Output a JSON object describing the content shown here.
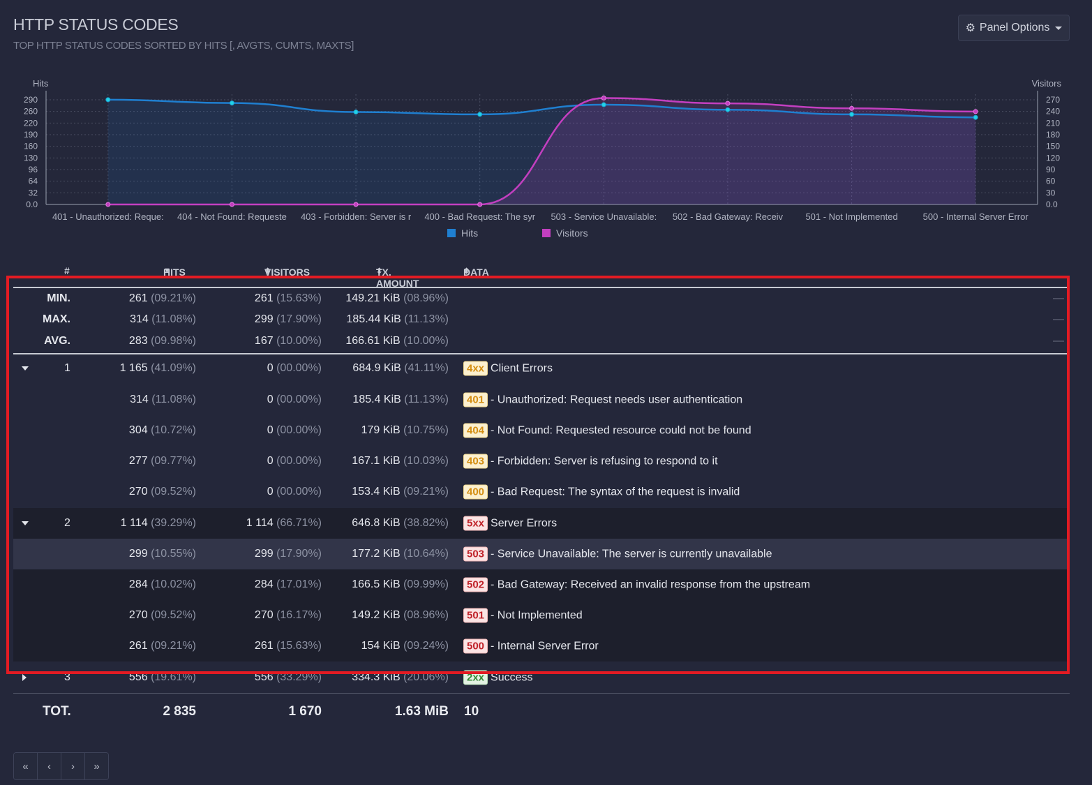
{
  "panel": {
    "title": "HTTP STATUS CODES",
    "subtitle": "TOP HTTP STATUS CODES SORTED BY HITS [, AVGTS, CUMTS, MAXTS]",
    "options_label": "Panel Options"
  },
  "chart_data": {
    "type": "area",
    "categories": [
      "401 - Unauthorized: Reque:",
      "404 - Not Found: Requeste",
      "403 - Forbidden: Server is r",
      "400 - Bad Request: The syr",
      "503 - Service Unavailable: ",
      "502 - Bad Gateway: Receiv",
      "501 - Not Implemented",
      "500 - Internal Server Error"
    ],
    "series": [
      {
        "name": "Hits",
        "values": [
          314,
          304,
          277,
          270,
          299,
          284,
          270,
          261
        ],
        "color": "#1f7fd0"
      },
      {
        "name": "Visitors",
        "values": [
          0,
          0,
          0,
          0,
          299,
          284,
          270,
          261
        ],
        "color": "#c33fc0"
      }
    ],
    "ylabel_left": "Hits",
    "ylabel_right": "Visitors",
    "yticks_left": [
      "290",
      "260",
      "220",
      "190",
      "160",
      "130",
      "96",
      "64",
      "32",
      "0.0"
    ],
    "yticks_right": [
      "270",
      "240",
      "210",
      "180",
      "150",
      "120",
      "90",
      "60",
      "30",
      "0.0"
    ],
    "ylim_left": [
      0,
      320
    ],
    "ylim_right": [
      0,
      300
    ],
    "legend_position": "bottom",
    "grid": true
  },
  "table": {
    "headers": {
      "num": "#",
      "hits": "HITS",
      "visitors": "VISITORS",
      "tx": "TX. AMOUNT",
      "data": "DATA"
    },
    "stats": [
      {
        "label": "MIN.",
        "hits": "261",
        "hits_pct": "(09.21%)",
        "visitors": "261",
        "visitors_pct": "(15.63%)",
        "tx": "149.21 KiB",
        "tx_pct": "(08.96%)",
        "dash": "—"
      },
      {
        "label": "MAX.",
        "hits": "314",
        "hits_pct": "(11.08%)",
        "visitors": "299",
        "visitors_pct": "(17.90%)",
        "tx": "185.44 KiB",
        "tx_pct": "(11.13%)",
        "dash": "—"
      },
      {
        "label": "AVG.",
        "hits": "283",
        "hits_pct": "(09.98%)",
        "visitors": "167",
        "visitors_pct": "(10.00%)",
        "tx": "166.61 KiB",
        "tx_pct": "(10.00%)",
        "dash": "—"
      }
    ],
    "groups": [
      {
        "num": "1",
        "hits": "1 165",
        "hits_pct": "(41.09%)",
        "visitors": "0",
        "visitors_pct": "(00.00%)",
        "tx": "684.9 KiB",
        "tx_pct": "(41.11%)",
        "badge": "4xx",
        "label": "Client Errors"
      },
      {
        "num": "2",
        "hits": "1 114",
        "hits_pct": "(39.29%)",
        "visitors": "1 114",
        "visitors_pct": "(66.71%)",
        "tx": "646.8 KiB",
        "tx_pct": "(38.82%)",
        "badge": "5xx",
        "label": "Server Errors"
      },
      {
        "num": "3",
        "hits": "556",
        "hits_pct": "(19.61%)",
        "visitors": "556",
        "visitors_pct": "(33.29%)",
        "tx": "334.3 KiB",
        "tx_pct": "(20.06%)",
        "badge": "2xx",
        "label": "Success"
      }
    ],
    "rows": [
      {
        "hits": "314",
        "hits_pct": "(11.08%)",
        "visitors": "0",
        "visitors_pct": "(00.00%)",
        "tx": "185.4 KiB",
        "tx_pct": "(11.13%)",
        "badge": "401",
        "label": "- Unauthorized: Request needs user authentication"
      },
      {
        "hits": "304",
        "hits_pct": "(10.72%)",
        "visitors": "0",
        "visitors_pct": "(00.00%)",
        "tx": "179 KiB",
        "tx_pct": "(10.75%)",
        "badge": "404",
        "label": "- Not Found: Requested resource could not be found"
      },
      {
        "hits": "277",
        "hits_pct": "(09.77%)",
        "visitors": "0",
        "visitors_pct": "(00.00%)",
        "tx": "167.1 KiB",
        "tx_pct": "(10.03%)",
        "badge": "403",
        "label": "- Forbidden: Server is refusing to respond to it"
      },
      {
        "hits": "270",
        "hits_pct": "(09.52%)",
        "visitors": "0",
        "visitors_pct": "(00.00%)",
        "tx": "153.4 KiB",
        "tx_pct": "(09.21%)",
        "badge": "400",
        "label": "- Bad Request: The syntax of the request is invalid"
      },
      {
        "hits": "299",
        "hits_pct": "(10.55%)",
        "visitors": "299",
        "visitors_pct": "(17.90%)",
        "tx": "177.2 KiB",
        "tx_pct": "(10.64%)",
        "badge": "503",
        "label": "- Service Unavailable: The server is currently unavailable"
      },
      {
        "hits": "284",
        "hits_pct": "(10.02%)",
        "visitors": "284",
        "visitors_pct": "(17.01%)",
        "tx": "166.5 KiB",
        "tx_pct": "(09.99%)",
        "badge": "502",
        "label": "- Bad Gateway: Received an invalid response from the upstream"
      },
      {
        "hits": "270",
        "hits_pct": "(09.52%)",
        "visitors": "270",
        "visitors_pct": "(16.17%)",
        "tx": "149.2 KiB",
        "tx_pct": "(08.96%)",
        "badge": "501",
        "label": "- Not Implemented"
      },
      {
        "hits": "261",
        "hits_pct": "(09.21%)",
        "visitors": "261",
        "visitors_pct": "(15.63%)",
        "tx": "154 KiB",
        "tx_pct": "(09.24%)",
        "badge": "500",
        "label": "- Internal Server Error"
      }
    ],
    "totals": {
      "label": "TOT.",
      "hits": "2 835",
      "visitors": "1 670",
      "tx": "1.63 MiB",
      "data": "10"
    }
  },
  "pager": {
    "first": "«",
    "prev": "‹",
    "next": "›",
    "last": "»"
  },
  "colors": {
    "hits": "#1f7fd0",
    "visitors": "#c33fc0",
    "highlight": "#e31b23"
  }
}
